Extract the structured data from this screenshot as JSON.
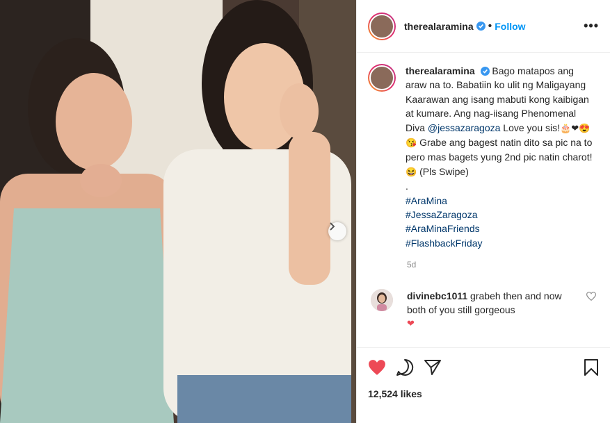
{
  "post": {
    "username": "therealaramina",
    "follow_label": "Follow",
    "more_label": "•••",
    "caption": {
      "username": "therealaramina",
      "line1": "Bago matapos ang araw na to. Babatiin ko ulit ng Maligayang Kaarawan ang isang mabuti kong kaibigan at kumare. Ang nag-iisang Phenomenal Diva",
      "mention": "@jessazaragoza",
      "line2": " Love you sis!",
      "emojis1": "🎂❤😍",
      "emojis2": "😘",
      "line3": " Grabe ang bagest natin dito sa pic na to pero mas bagets yung 2nd pic natin charot! ",
      "emojis3": "😆",
      "line4": " (Pls Swipe)",
      "dot": ".",
      "hashtags": [
        "#AraMina",
        "#JessaZaragoza",
        "#AraMinaFriends",
        "#FlashbackFriday"
      ]
    },
    "timestamp": "5d",
    "comments": [
      {
        "username": "divinebc1011",
        "text": " grabeh then and now both of you still gorgeous",
        "emoji": "❤"
      }
    ],
    "likes": "12,524 likes",
    "colors": {
      "accent": "#0095f6",
      "like": "#ed4956"
    },
    "icons": [
      "verified-icon",
      "more-icon",
      "heart-icon",
      "comment-icon",
      "share-icon",
      "save-icon",
      "chevron-right-icon"
    ]
  }
}
